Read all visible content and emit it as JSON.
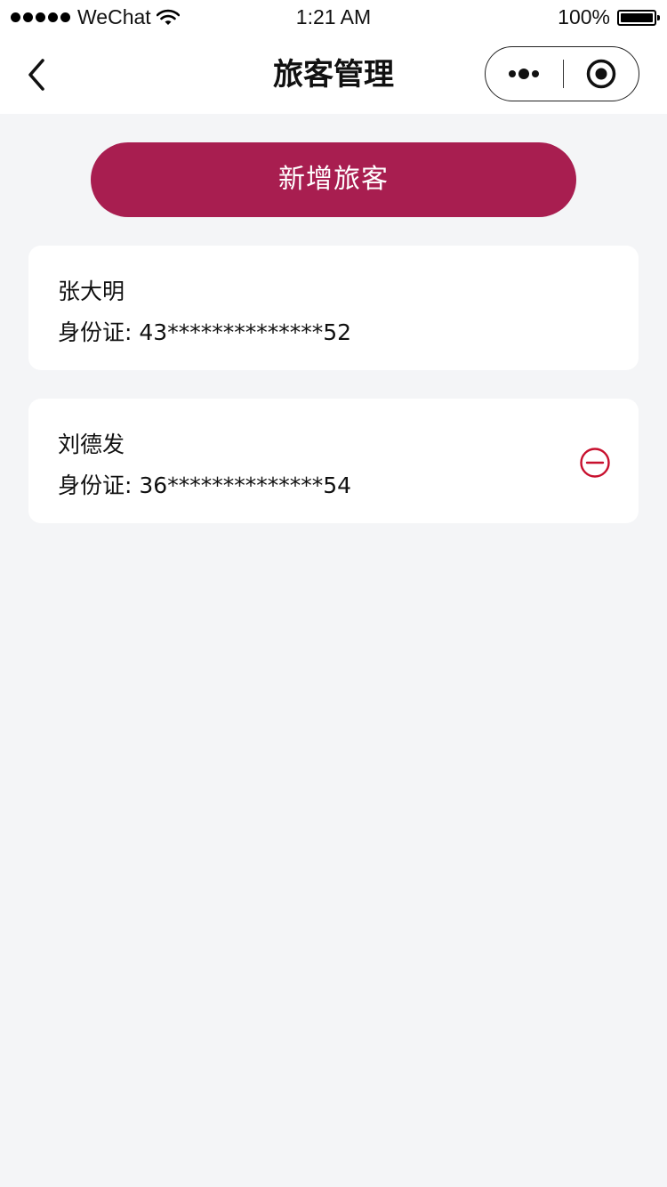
{
  "status_bar": {
    "carrier": "WeChat",
    "time": "1:21 AM",
    "battery": "100%"
  },
  "nav": {
    "title": "旅客管理",
    "back_icon": "chevron-left-icon",
    "more_icon": "more-dots-icon",
    "close_icon": "target-circle-icon"
  },
  "add_button": {
    "label": "新增旅客",
    "color": "#a81e50"
  },
  "travelers": [
    {
      "name": "张大明",
      "id_label": "身份证",
      "id_sep": ": ",
      "id_value": "43**************52",
      "removable": false
    },
    {
      "name": "刘德发",
      "id_label": "身份证",
      "id_sep": ": ",
      "id_value": "36**************54",
      "removable": true,
      "remove_icon": "minus-circle-icon",
      "remove_color": "#c8102e"
    }
  ]
}
